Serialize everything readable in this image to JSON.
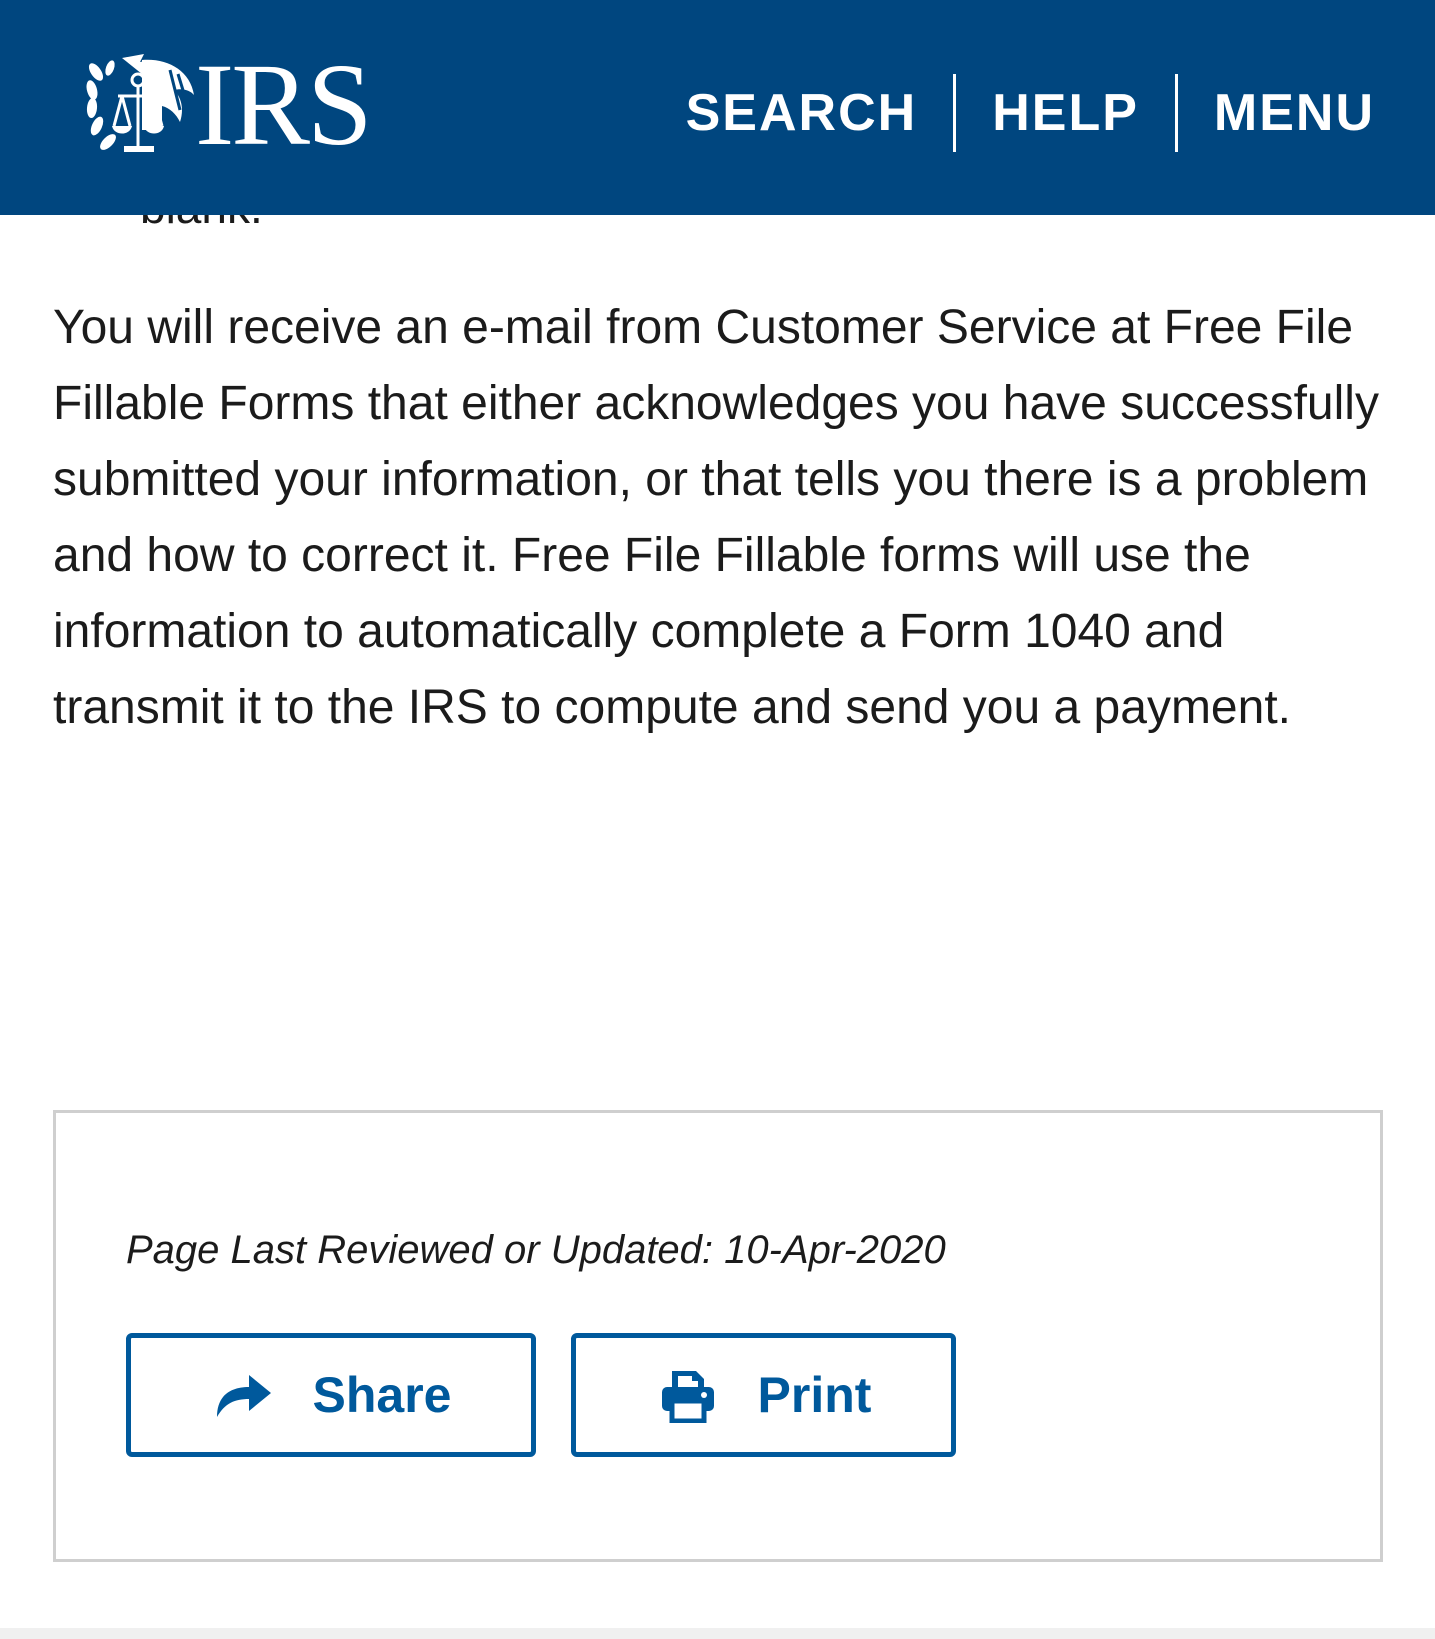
{
  "header": {
    "logo_text": "IRS",
    "nav": {
      "search": "SEARCH",
      "help": "HELP",
      "menu": "MENU"
    }
  },
  "content": {
    "partial_line": "blank.",
    "paragraph": "You will receive an e-mail from Customer Service at Free File Fillable Forms that either acknowledges you have successfully submitted your information, or that tells you there is a problem and how to correct it. Free File Fillable forms will use the information to automatically complete a Form 1040 and transmit it to the IRS to compute and send you a payment."
  },
  "footer_box": {
    "last_reviewed": "Page Last Reviewed or Updated: 10-Apr-2020",
    "share_label": "Share",
    "print_label": "Print"
  },
  "colors": {
    "header_bg": "#00467f",
    "accent": "#00599c",
    "text": "#1b1b1b"
  },
  "icons": [
    "irs-eagle-logo-icon",
    "share-arrow-icon",
    "printer-icon"
  ]
}
